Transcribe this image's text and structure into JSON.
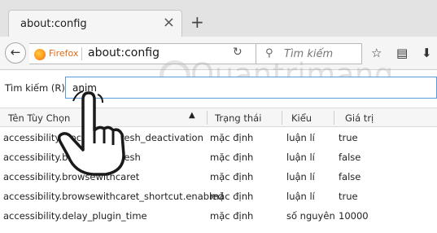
{
  "tab": {
    "title": "about:config",
    "close_glyph": "×"
  },
  "newtab_glyph": "+",
  "nav": {
    "identity": "Firefox",
    "url": "about:config",
    "search_placeholder": "Tìm kiếm"
  },
  "filter": {
    "label": "Tìm kiếm (R):",
    "value": "anim"
  },
  "columns": {
    "name": "Tên Tùy Chọn",
    "status": "Trạng thái",
    "type": "Kiểu",
    "value": "Giá trị"
  },
  "rows": [
    {
      "name": "accessibility.blockautorefresh_deactivation",
      "status": "mặc định",
      "type": "luận lí",
      "value": "true"
    },
    {
      "name": "accessibility.blockautorefresh",
      "status": "mặc định",
      "type": "luận lí",
      "value": "false"
    },
    {
      "name": "accessibility.browsewithcaret",
      "status": "mặc định",
      "type": "luận lí",
      "value": "false"
    },
    {
      "name": "accessibility.browsewithcaret_shortcut.enabled",
      "status": "mặc định",
      "type": "luận lí",
      "value": "true"
    },
    {
      "name": "accessibility.delay_plugin_time",
      "status": "mặc định",
      "type": "số nguyên",
      "value": "10000"
    }
  ],
  "watermark": "Quantrimang"
}
